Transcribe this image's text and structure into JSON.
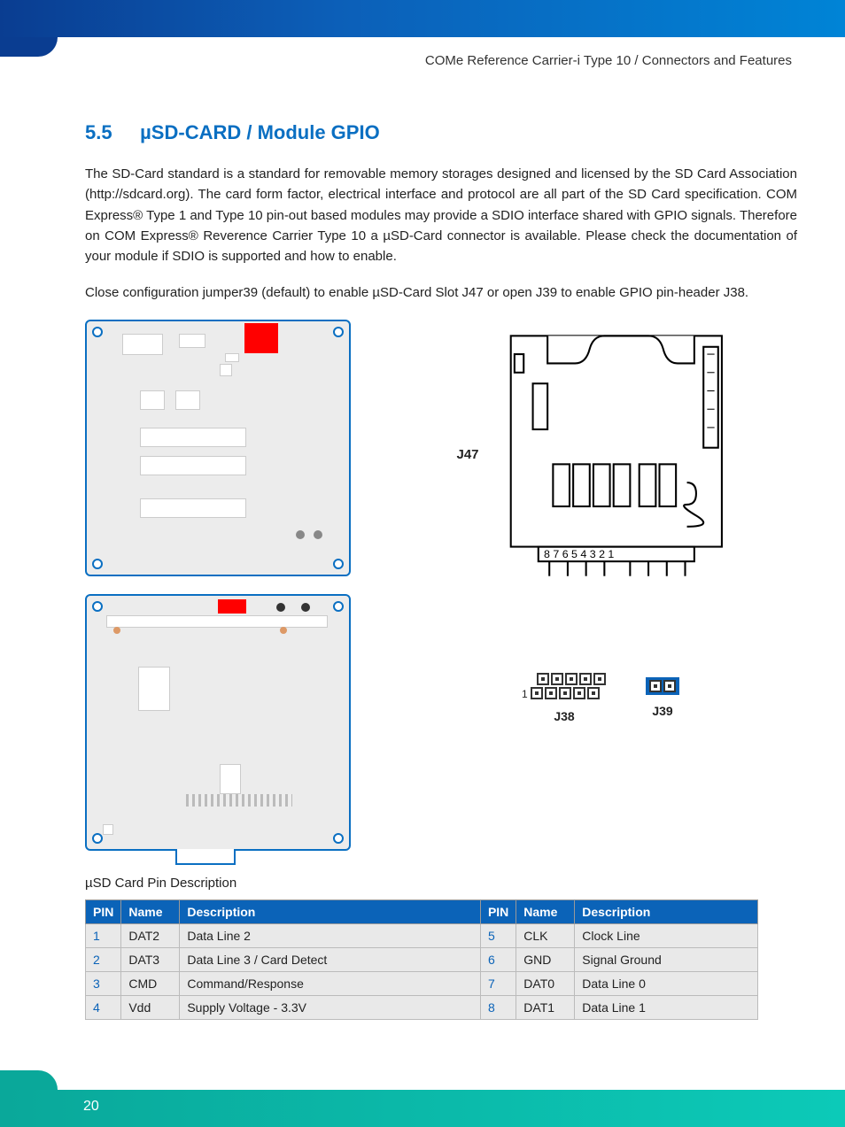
{
  "breadcrumb": "COMe Reference Carrier-i Type 10 / Connectors and Features",
  "section_number": "5.5",
  "section_title": "µSD-CARD / Module GPIO",
  "para1": "The SD-Card standard is a standard for removable memory storages designed and licensed by the SD Card Association (http://sdcard.org). The card form factor, electrical interface and protocol are all part of the SD Card specification. COM Express® Type 1 and Type 10 pin-out based modules may provide a SDIO interface shared with GPIO signals. Therefore on COM Express® Reverence Carrier Type 10 a µSD-Card connector is available. Please check the documentation of your module if SDIO is supported and how to enable.",
  "para2": "Close configuration jumper39 (default) to enable µSD-Card Slot J47 or open J39 to enable GPIO pin-header J38.",
  "labels": {
    "j47": "J47",
    "j38": "J38",
    "j39": "J39",
    "j38_marker": "1",
    "sd_pins": "8  7  6  5    4  3  2  1"
  },
  "table_caption": "µSD Card Pin Description",
  "table_headers": {
    "pin": "PIN",
    "name": "Name",
    "desc": "Description"
  },
  "pins_left": [
    {
      "pin": "1",
      "name": "DAT2",
      "desc": "Data Line 2"
    },
    {
      "pin": "2",
      "name": "DAT3",
      "desc": "Data Line 3 / Card Detect"
    },
    {
      "pin": "3",
      "name": "CMD",
      "desc": "Command/Response"
    },
    {
      "pin": "4",
      "name": "Vdd",
      "desc": "Supply Voltage - 3.3V"
    }
  ],
  "pins_right": [
    {
      "pin": "5",
      "name": "CLK",
      "desc": "Clock Line"
    },
    {
      "pin": "6",
      "name": "GND",
      "desc": "Signal Ground"
    },
    {
      "pin": "7",
      "name": "DAT0",
      "desc": "Data Line 0"
    },
    {
      "pin": "8",
      "name": "DAT1",
      "desc": "Data Line 1"
    }
  ],
  "page_number": "20"
}
